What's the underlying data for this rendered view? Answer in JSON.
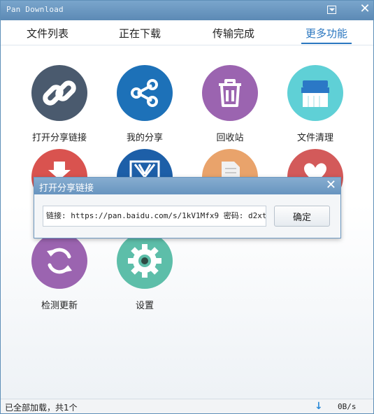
{
  "window": {
    "title": "Pan Download"
  },
  "tabs": [
    {
      "label": "文件列表"
    },
    {
      "label": "正在下载"
    },
    {
      "label": "传输完成"
    },
    {
      "label": "更多功能",
      "active": true
    }
  ],
  "features": [
    {
      "label": "打开分享链接",
      "icon": "link-icon",
      "color": "#4a5a6e"
    },
    {
      "label": "我的分享",
      "icon": "share-icon",
      "color": "#1d71b8"
    },
    {
      "label": "回收站",
      "icon": "trash-icon",
      "color": "#9b64b0"
    },
    {
      "label": "文件清理",
      "icon": "broom-icon",
      "color": "#5fd0d6"
    },
    {
      "label": "",
      "icon": "download-icon",
      "color": "#d9534f"
    },
    {
      "label": "",
      "icon": "book-icon",
      "color": "#1d5fa8"
    },
    {
      "label": "",
      "icon": "document-icon",
      "color": "#e9a36b"
    },
    {
      "label": "",
      "icon": "heart-icon",
      "color": "#d35a5a"
    },
    {
      "label": "检测更新",
      "icon": "refresh-icon",
      "color": "#9b64b0"
    },
    {
      "label": "设置",
      "icon": "gear-icon",
      "color": "#5dbea9"
    }
  ],
  "dialog": {
    "title": "打开分享链接",
    "input_value": "链接: https://pan.baidu.com/s/1kV1Mfx9 密码: d2xt",
    "ok_label": "确定"
  },
  "status": {
    "text": "已全部加载，共1个",
    "speed": "0B/s"
  }
}
